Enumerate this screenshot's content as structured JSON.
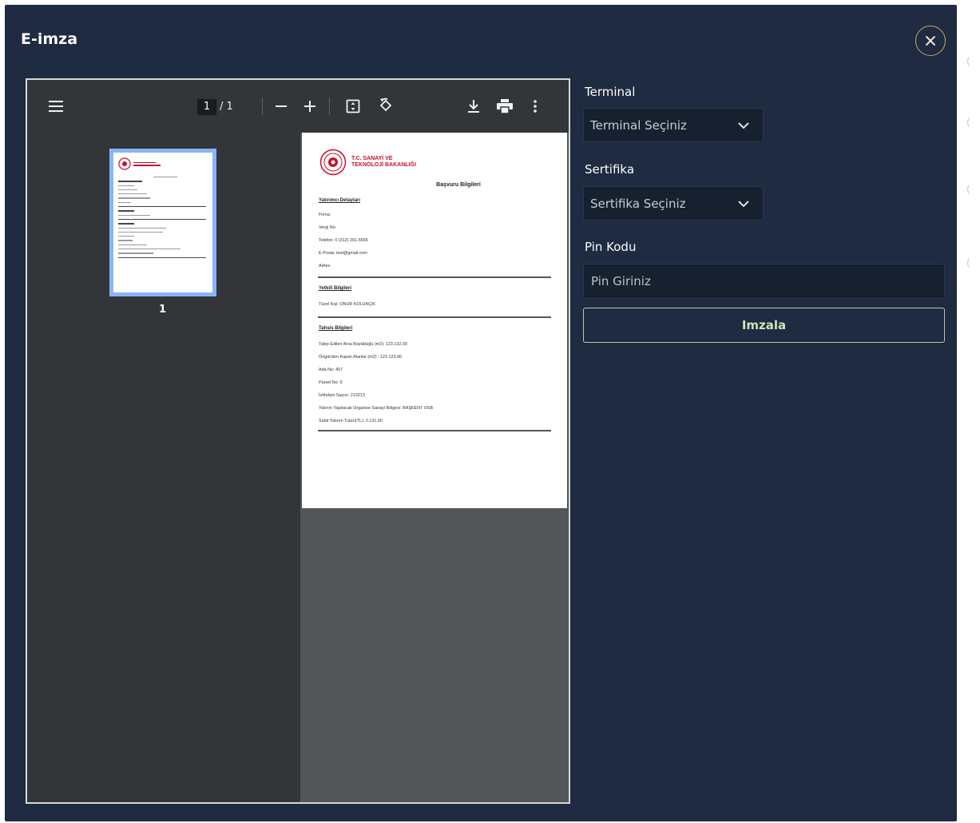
{
  "modal": {
    "title": "E-imza"
  },
  "viewer": {
    "current_page": "1",
    "page_total": "/ 1",
    "thumb_page_number": "1"
  },
  "document": {
    "org_line1": "T.C. SANAYİ VE",
    "org_line2": "TEKNOLOJİ BAKANLIĞI",
    "title": "Başvuru Bilgileri",
    "sections": [
      {
        "heading": "Yatırımcı Detayları",
        "fields": [
          "Firma:",
          "Vergi No:",
          "Telefon: 0 (312) 201-5655",
          "E-Posta: test@gmail.com",
          "Adres:"
        ]
      },
      {
        "heading": "Yetkili Bilgileri",
        "fields": [
          "Tüzel Kişi: ONUR KOLUAÇIK"
        ]
      },
      {
        "heading": "Tahsis Bilgileri",
        "fields": [
          "Talep Edilen Arsa Büyüklüğü (m2): 123.132,00",
          "Öngörülen Kapalı Alanlar (m2) : 123.123,00",
          "Ada No: 457",
          "Parsel No: 9",
          "İstihdam Sayısı: 213213",
          "Yatırım Yapılacak Organize Sanayi Bölgesi: BAŞKENT OSB",
          "Sabit Yatırım Tutarı(TL): 2.131,00"
        ]
      }
    ]
  },
  "form": {
    "terminal_label": "Terminal",
    "terminal_value": "Terminal Seçiniz",
    "certificate_label": "Sertifika",
    "certificate_value": "Sertifika Seçiniz",
    "pin_label": "Pin Kodu",
    "pin_placeholder": "Pin Giriniz",
    "sign_button": "Imzala"
  },
  "colors": {
    "modal_bg": "#1e2b40",
    "accent_close": "#c9a86a",
    "sign_text": "#c9e6b9",
    "logo_red": "#c8102e"
  },
  "icons": {
    "close": "close-icon",
    "menu": "menu-icon",
    "zoom_out": "minus-icon",
    "zoom_in": "plus-icon",
    "fit": "fit-page-icon",
    "rotate": "rotate-icon",
    "download": "download-icon",
    "print": "print-icon",
    "more": "more-vert-icon",
    "chevron": "chevron-down-icon"
  }
}
